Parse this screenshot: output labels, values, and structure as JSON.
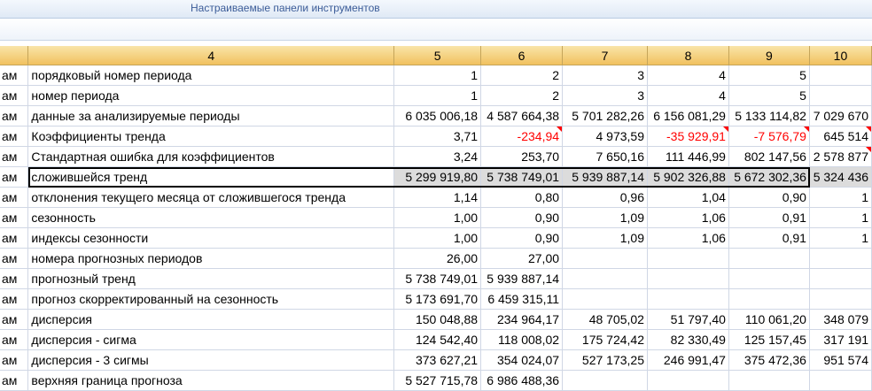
{
  "ribbon": {
    "title": "Настраиваемые панели инструментов"
  },
  "sheet": {
    "headers": [
      "",
      "4",
      "5",
      "6",
      "7",
      "8",
      "9",
      "10"
    ],
    "rows": [
      {
        "cells": [
          "ам",
          "порядковый номер периода",
          "1",
          "2",
          "3",
          "4",
          "5",
          ""
        ]
      },
      {
        "cells": [
          "ам",
          "номер периода",
          "1",
          "2",
          "3",
          "4",
          "5",
          ""
        ]
      },
      {
        "cells": [
          "ам",
          "данные за анализируемые периоды",
          "6 035 006,18",
          "4 587 664,38",
          "5 701 282,26",
          "6 156 081,29",
          "5 133 114,82",
          "7 029 670"
        ]
      },
      {
        "cells": [
          "ам",
          "Коэффициенты тренда",
          "3,71",
          "-234,94",
          "4 973,59",
          "-35 929,91",
          "-7 576,79",
          "645 514"
        ]
      },
      {
        "cells": [
          "ам",
          "Стандартная ошибка для коэффициентов",
          "3,24",
          "253,70",
          "7 650,16",
          "111 446,99",
          "802 147,56",
          "2 578 877"
        ]
      },
      {
        "cells": [
          "ам",
          "сложившейся тренд",
          "5 299 919,80",
          "5 738 749,01",
          "5 939 887,14",
          "5 902 326,88",
          "5 672 302,36",
          "5 324 436"
        ]
      },
      {
        "cells": [
          "ам",
          "отклонения текущего месяца от сложившегося тренда",
          "1,14",
          "0,80",
          "0,96",
          "1,04",
          "0,90",
          "1"
        ]
      },
      {
        "cells": [
          "ам",
          "сезонность",
          "1,00",
          "0,90",
          "1,09",
          "1,06",
          "0,91",
          "1"
        ]
      },
      {
        "cells": [
          "ам",
          "индексы сезонности",
          "1,00",
          "0,90",
          "1,09",
          "1,06",
          "0,91",
          "1"
        ]
      },
      {
        "cells": [
          "ам",
          "номера прогнозных периодов",
          "26,00",
          "27,00",
          "",
          "",
          "",
          ""
        ]
      },
      {
        "cells": [
          "ам",
          "прогнозный тренд",
          "5 738 749,01",
          "5 939 887,14",
          "",
          "",
          "",
          ""
        ]
      },
      {
        "cells": [
          "ам",
          "прогноз скорректированный на сезонность",
          "5 173 691,70",
          "6 459 315,11",
          "",
          "",
          "",
          ""
        ]
      },
      {
        "cells": [
          "ам",
          "дисперсия",
          "150 048,88",
          "234 964,17",
          "48 705,02",
          "51 797,40",
          "110 061,20",
          "348 079"
        ]
      },
      {
        "cells": [
          "ам",
          "дисперсия - сигма",
          "124 542,40",
          "118 008,02",
          "175 724,42",
          "82 330,49",
          "125 157,45",
          "317 191"
        ]
      },
      {
        "cells": [
          "ам",
          "дисперсия - 3 сигмы",
          "373 627,21",
          "354 024,07",
          "527 173,25",
          "246 991,47",
          "375 472,36",
          "951 574"
        ]
      },
      {
        "cells": [
          "ам",
          "верхняя граница прогноза",
          "5 527 715,78",
          "6 986 488,36",
          "",
          "",
          "",
          ""
        ]
      }
    ]
  }
}
